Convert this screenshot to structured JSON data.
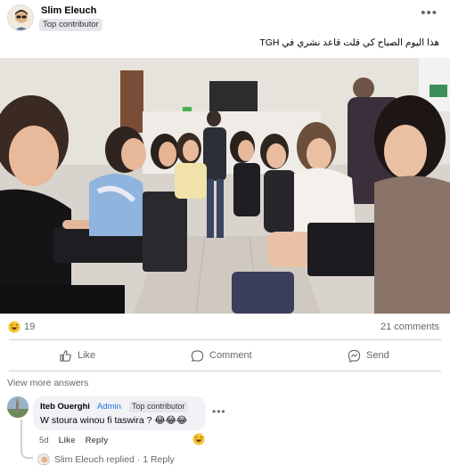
{
  "post": {
    "author": "Slim Eleuch",
    "badge": "Top contributor",
    "text": "هذا اليوم الصباح كي قلت قاعد نشري في TGH",
    "more_label": "•••"
  },
  "stats": {
    "reaction_count": "19",
    "comments_label": "21 comments"
  },
  "actions": {
    "like": "Like",
    "comment": "Comment",
    "send": "Send"
  },
  "comments_section": {
    "view_more": "View more answers",
    "comment": {
      "author": "Iteb Ouerghi",
      "role": "Admin",
      "badge": "Top contributor",
      "text": "W stoura winou fi taswira ? 😂😂😂",
      "age": "5d",
      "like_label": "Like",
      "reply_label": "Reply",
      "more_label": "•••"
    },
    "reply_summary": "Slim Eleuch replied · 1 Reply"
  },
  "colors": {
    "accent_blue": "#1b74e4",
    "muted_text": "#65676b",
    "bubble_bg": "#f0f2f5"
  },
  "icons": [
    "more-icon",
    "haha-reaction-icon",
    "like-thumb-icon",
    "comment-bubble-icon",
    "send-messenger-icon"
  ]
}
